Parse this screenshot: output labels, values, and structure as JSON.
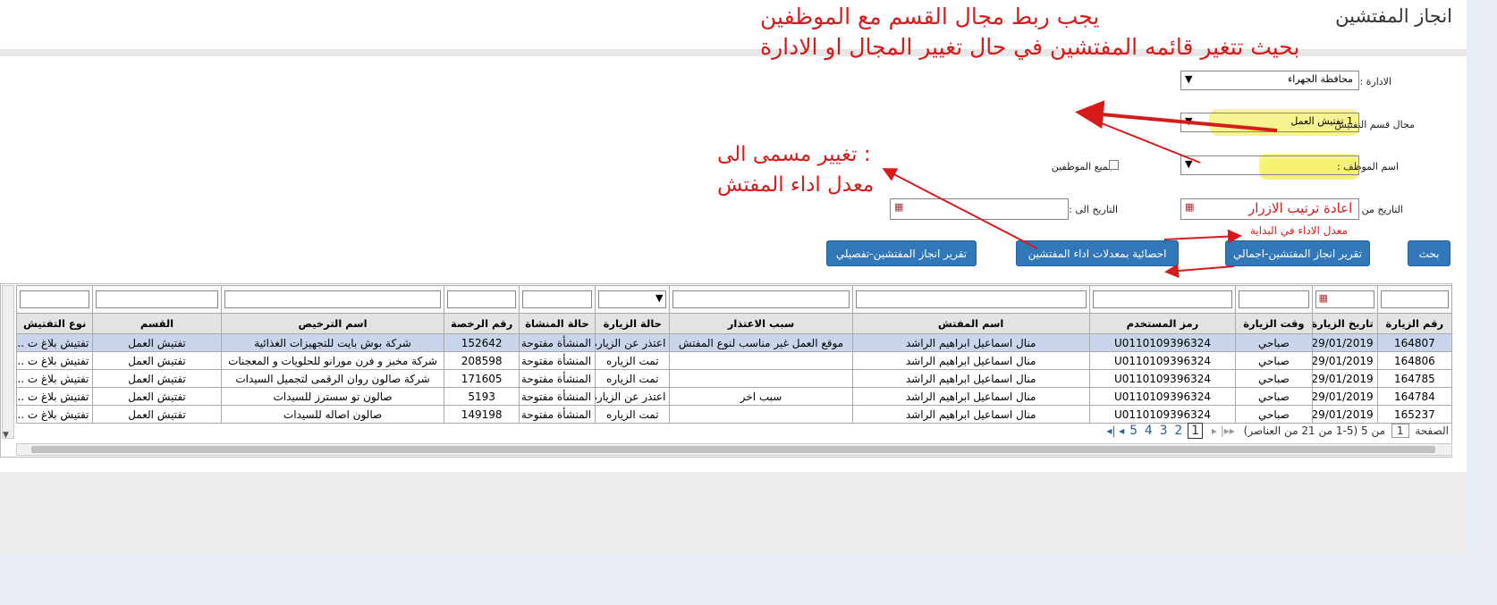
{
  "page_title": "انجاز المفتشين",
  "annotations": {
    "line1": "يجب ربط مجال القسم مع الموظفين",
    "line2": "بحيث تتغير قائمه المفتشين في حال تغيير المجال  او الادارة",
    "rename1": ": تغيير مسمى الى",
    "rename2": "معدل اداء المفتش",
    "reorder": "اعادة ترتيب الازرار",
    "reorder2": "معدل الاداء في البداية"
  },
  "form": {
    "admin_label": "الادارة :",
    "admin_value": "محافظة الجهراء",
    "section_label": "مجال قسم التفتيش",
    "section_value": "1 تفتيش العمل",
    "employee_label": "اسم الموظف :",
    "employee_value": "",
    "all_employees_label": "جميع الموظفين",
    "date_from_label": "التاريخ من :",
    "date_to_label": "التاريخ الى :"
  },
  "buttons": {
    "search": "بحث",
    "summary_report": "تقرير انجاز المفتشين-اجمالي",
    "stats": "احصائية بمعدلات اداء المفتشين",
    "detailed_report": "تقرير انجاز المفتشين-تفصيلي"
  },
  "table": {
    "columns": [
      "رقم الزيارة",
      "تاريخ الزيارة",
      "وقت الزيارة",
      "رمز المستخدم",
      "اسم المفتش",
      "سبب الاعتذار",
      "حالة الزيارة",
      "حالة المنشاة",
      "رقم الرخصة",
      "اسم الترخيص",
      "القسم",
      "نوع التفتيش"
    ],
    "rows": [
      [
        "164807",
        "29/01/2019",
        "صباحي",
        "U0110109396324",
        "منال اسماعيل ابراهيم الراشد",
        "موقع العمل غير مناسب لنوع المفتش",
        "اعتذر عن الزياره",
        "المنشأة مفتوحة",
        "152642",
        "شركة بوش بايت للتجهيزات الغذائية",
        "تفتيش العمل",
        "تفتيش بلاغ ت .."
      ],
      [
        "164806",
        "29/01/2019",
        "صباحي",
        "U0110109396324",
        "منال اسماعيل ابراهيم الراشد",
        "",
        "تمت الزياره",
        "المنشأة مفتوحة",
        "208598",
        "شركة مخبز و فرن مورانو للحلويات و المعجنات",
        "تفتيش العمل",
        "تفتيش بلاغ ت .."
      ],
      [
        "164785",
        "29/01/2019",
        "صباحي",
        "U0110109396324",
        "منال اسماعيل ابراهيم الراشد",
        "",
        "تمت الزياره",
        "المنشأة مفتوحة",
        "171605",
        "شركة صالون روان الرقمى لتجميل السيدات",
        "تفتيش العمل",
        "تفتيش بلاغ ت .."
      ],
      [
        "164784",
        "29/01/2019",
        "صباحي",
        "U0110109396324",
        "منال اسماعيل ابراهيم الراشد",
        "سبب اخر",
        "اعتذر عن الزياره",
        "المنشأة مفتوحة",
        "5193",
        "صالون تو سسترز للسيدات",
        "تفتيش العمل",
        "تفتيش بلاغ ت .."
      ],
      [
        "165237",
        "29/01/2019",
        "صباحي",
        "U0110109396324",
        "منال اسماعيل ابراهيم الراشد",
        "",
        "تمت الزياره",
        "المنشأة مفتوحة",
        "149198",
        "صالون اصاله للسيدات",
        "تفتيش العمل",
        "تفتيش بلاغ ت .."
      ]
    ]
  },
  "pager": {
    "page_label": "الصفحة",
    "current_page": "1",
    "of_text": "من 5 (5-1 من 21 من العناصر)",
    "pages": [
      "1",
      "2",
      "3",
      "4",
      "5"
    ]
  },
  "colors": {
    "button": "#3278b8",
    "annotation": "#d71b1b",
    "highlight": "#f4f06a"
  }
}
